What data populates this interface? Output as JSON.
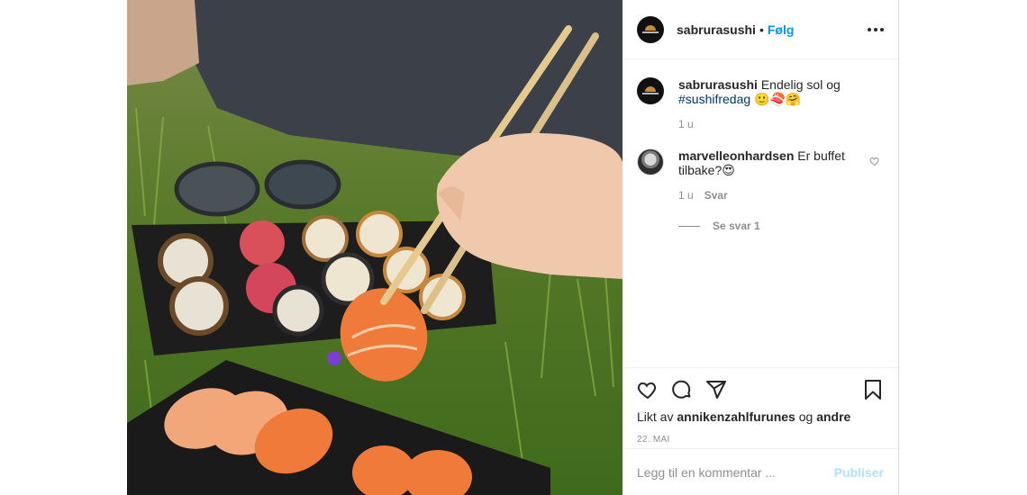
{
  "post": {
    "image_alt": "Sushi i gresset",
    "account": {
      "username": "sabrurasushi",
      "separator": "•",
      "follow_label": "Følg"
    },
    "caption": {
      "author": "sabrurasushi",
      "text_before": "Endelig sol og",
      "hashtag": "#sushifredag",
      "emoji": "🙂🍣🤗",
      "time": "1 u"
    },
    "comments": [
      {
        "author": "marvelleonhardsen",
        "text": "Er buffet tilbake?😍",
        "time": "1 u",
        "reply_label": "Svar",
        "see_replies_label": "Se svar 1"
      }
    ],
    "likes": {
      "prefix": "Likt av",
      "first_user": "annikenzahlfurunes",
      "conjunction": "og",
      "others": "andre"
    },
    "date": "22. MAI",
    "add_comment": {
      "placeholder": "Legg til en kommentar ...",
      "publish_label": "Publiser"
    }
  },
  "colors": {
    "link_blue": "#0095f6",
    "hashtag_blue": "#00376b",
    "muted": "#8e8e8e",
    "publish_disabled": "#b2dffc"
  },
  "icons": [
    "more-options-icon",
    "heart-icon",
    "comment-icon",
    "share-icon",
    "bookmark-icon",
    "small-heart-icon"
  ]
}
